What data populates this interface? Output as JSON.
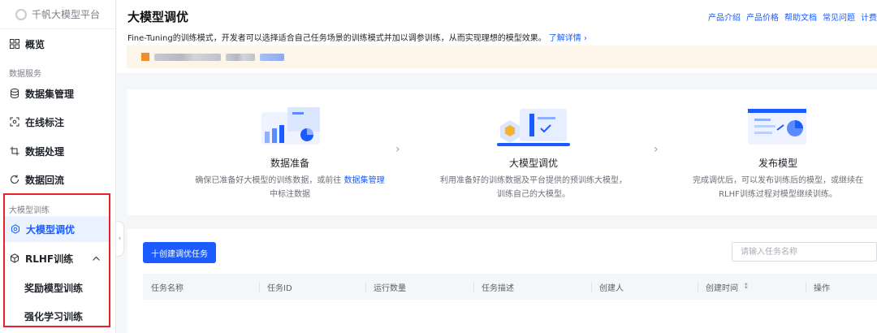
{
  "sidebar": {
    "brand": "千帆大模型平台",
    "overview": "概览",
    "group_data": "数据服务",
    "data_items": [
      "数据集管理",
      "在线标注",
      "数据处理",
      "数据回流"
    ],
    "group_training": "大模型训练",
    "training_active": "大模型调优",
    "rlhf": "RLHF训练",
    "rlhf_children": [
      "奖励模型训练",
      "强化学习训练"
    ],
    "collapse_glyph": "‹"
  },
  "header": {
    "title": "大模型调优",
    "links": [
      "产品介绍",
      "产品价格",
      "帮助文档",
      "常见问题",
      "计费"
    ],
    "description": "Fine-Tuning的训练模式，开发者可以选择适合自己任务场景的训练模式并加以调参训练，从而实现理想的模型效果。",
    "learn_more": "了解详情 ›"
  },
  "steps": [
    {
      "title": "数据准备",
      "desc_pre": "确保已准备好大模型的训练数据，或前往 ",
      "link": "数据集管理",
      "desc_post": " 中标注数据"
    },
    {
      "title": "大模型调优",
      "desc": "利用准备好的训练数据及平台提供的预训练大模型，训练自己的大模型。"
    },
    {
      "title": "发布模型",
      "desc": "完成调优后，可以发布训练后的模型，或继续在RLHF训练过程对模型继续训练。"
    }
  ],
  "step_arrow": "›",
  "tasks": {
    "create_button": "十创建调优任务",
    "search_placeholder": "请输入任务名称",
    "columns": [
      "任务名称",
      "任务ID",
      "运行数量",
      "任务描述",
      "创建人",
      "创建时间",
      "操作"
    ],
    "sort_glyph": "↕"
  },
  "colors": {
    "accent": "#1a5cff",
    "highlight_border": "#e8212b",
    "notice_bg": "#fdf5e9"
  }
}
